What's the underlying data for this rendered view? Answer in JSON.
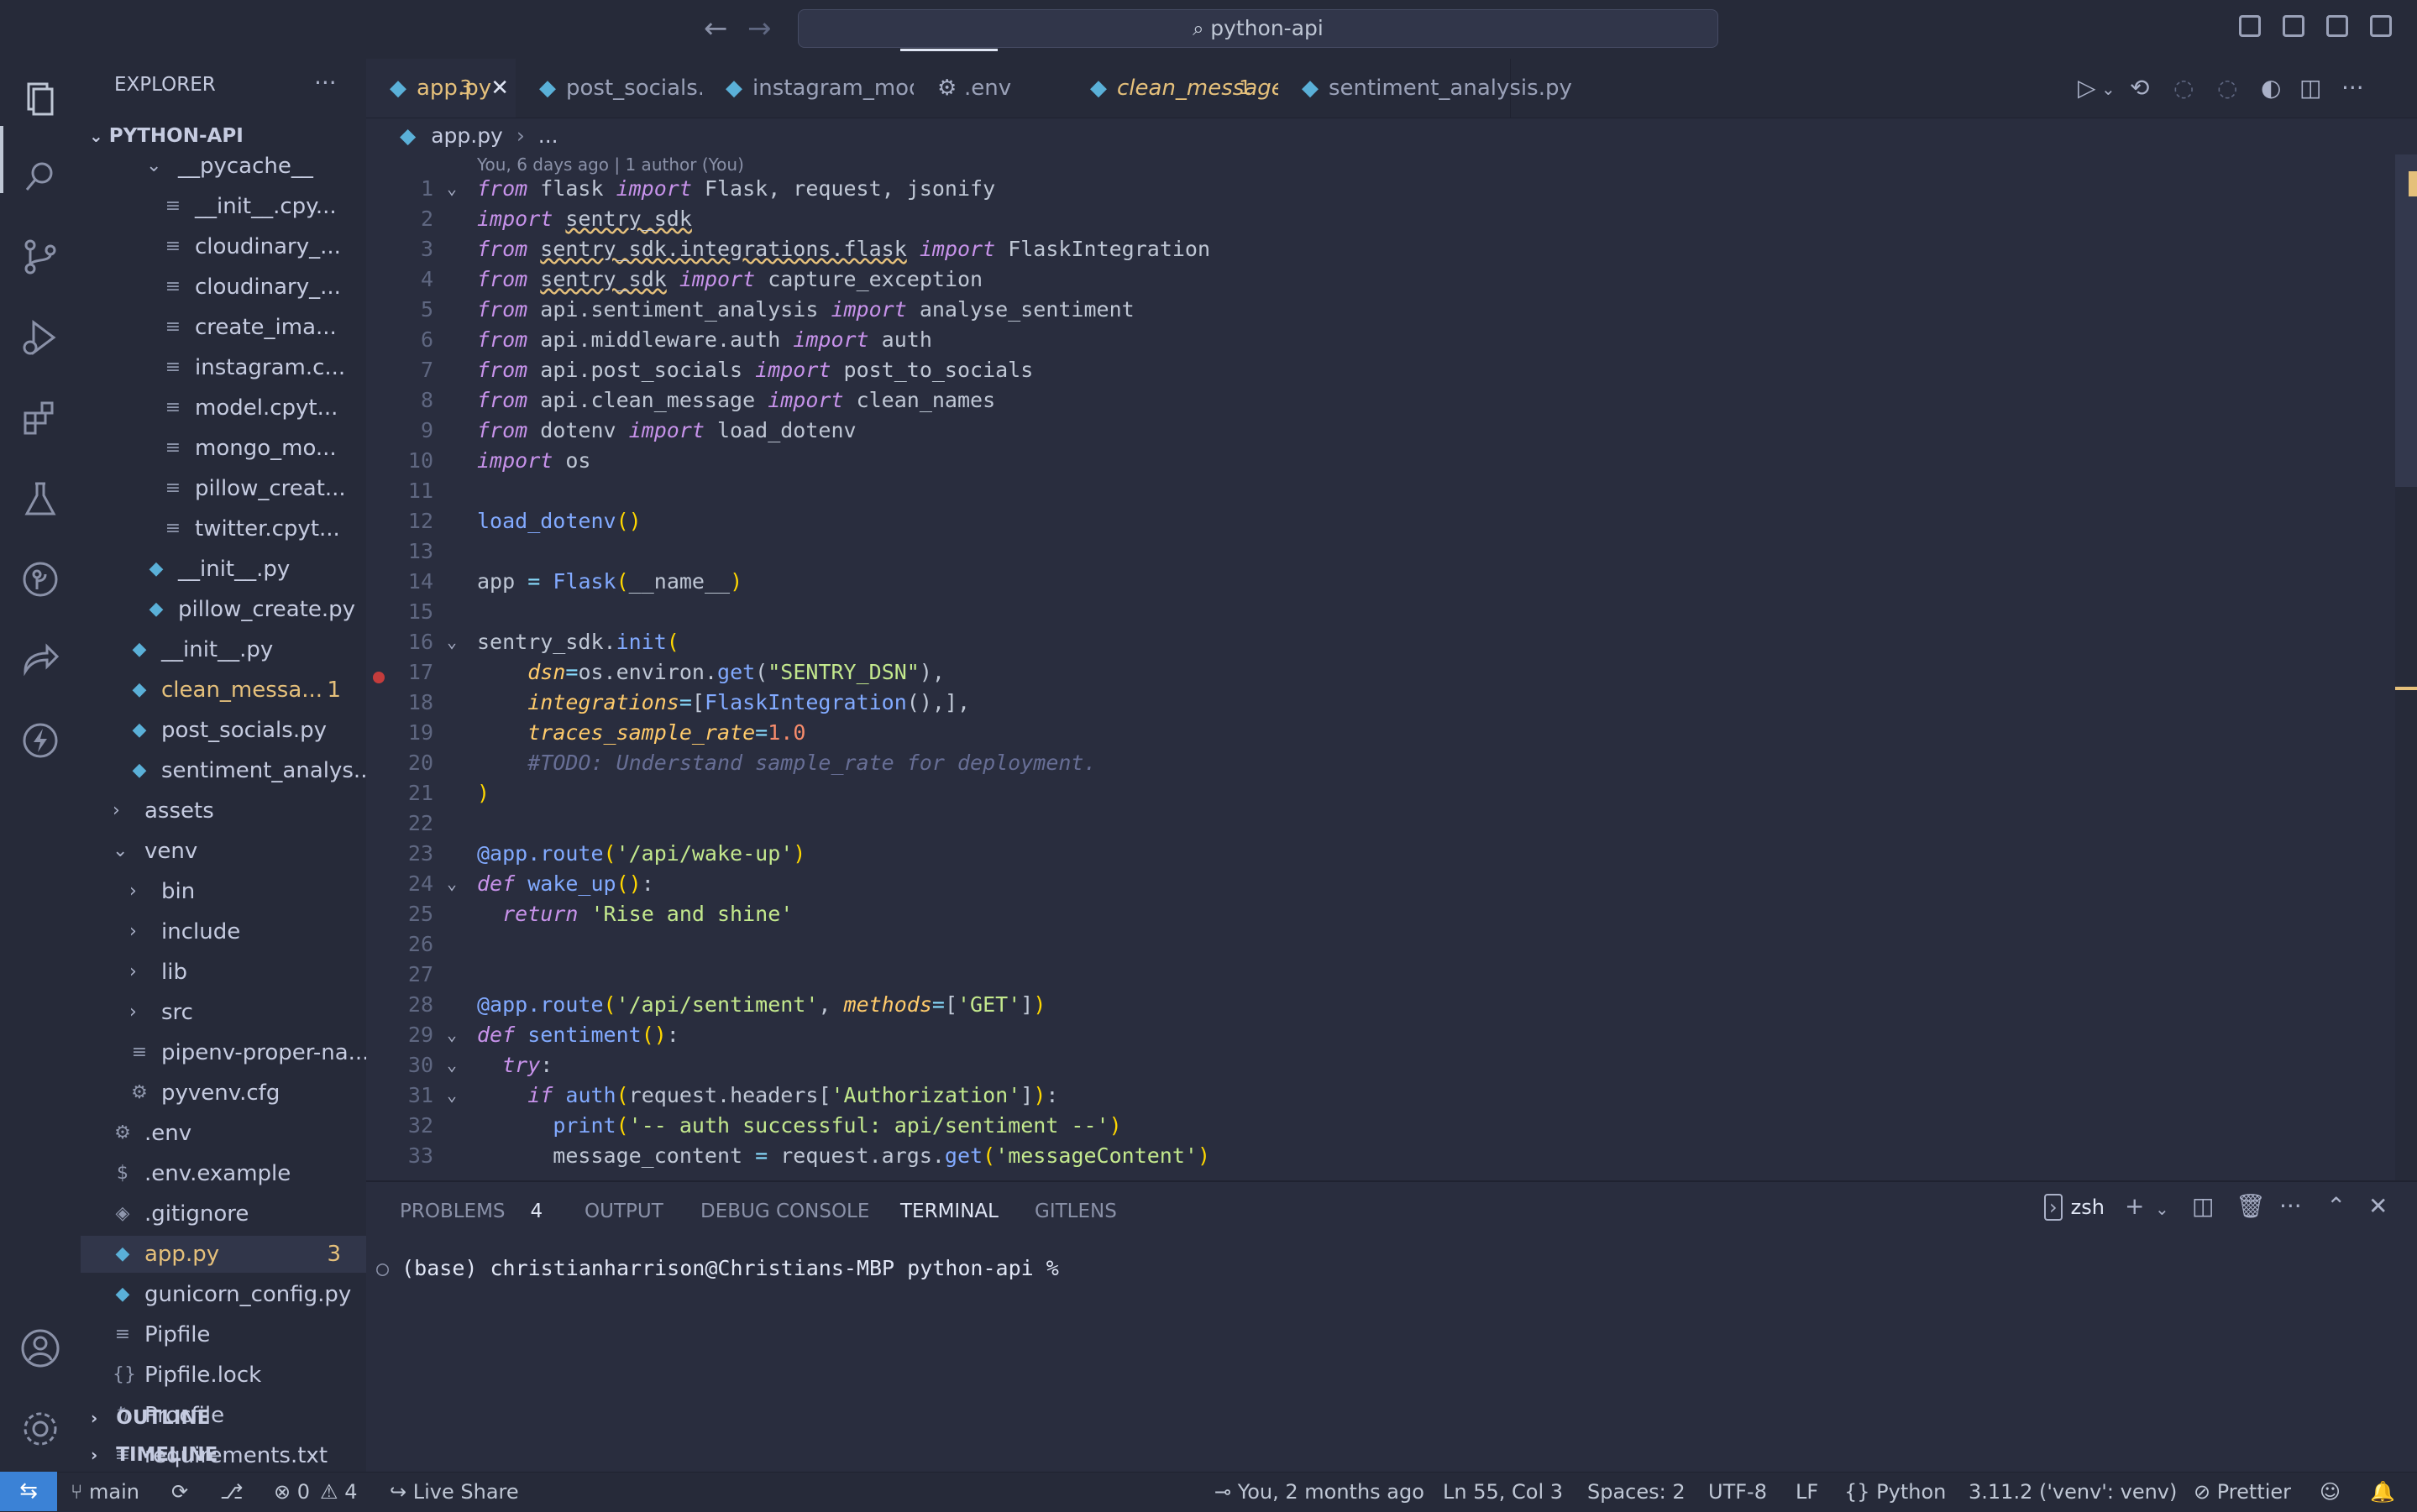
{
  "titlebar": {
    "search_text": "python-api"
  },
  "sidebar": {
    "title": "EXPLORER",
    "root": "PYTHON-API",
    "items": [
      {
        "label": "__pycache__",
        "kind": "folder-open",
        "indent": 3
      },
      {
        "label": "__init__.cpy...",
        "kind": "txt",
        "indent": 4
      },
      {
        "label": "cloudinary_...",
        "kind": "txt",
        "indent": 4
      },
      {
        "label": "cloudinary_...",
        "kind": "txt",
        "indent": 4
      },
      {
        "label": "create_ima...",
        "kind": "txt",
        "indent": 4
      },
      {
        "label": "instagram.c...",
        "kind": "txt",
        "indent": 4
      },
      {
        "label": "model.cpyt...",
        "kind": "txt",
        "indent": 4
      },
      {
        "label": "mongo_mo...",
        "kind": "txt",
        "indent": 4
      },
      {
        "label": "pillow_creat...",
        "kind": "txt",
        "indent": 4
      },
      {
        "label": "twitter.cpyt...",
        "kind": "txt",
        "indent": 4
      },
      {
        "label": "__init__.py",
        "kind": "py",
        "indent": 3
      },
      {
        "label": "pillow_create.py",
        "kind": "py",
        "indent": 3
      },
      {
        "label": "__init__.py",
        "kind": "py",
        "indent": 2
      },
      {
        "label": "clean_messa...",
        "kind": "py",
        "indent": 2,
        "badge": "1",
        "warn": true
      },
      {
        "label": "post_socials.py",
        "kind": "py",
        "indent": 2
      },
      {
        "label": "sentiment_analys...",
        "kind": "py",
        "indent": 2
      },
      {
        "label": "assets",
        "kind": "folder",
        "indent": 1
      },
      {
        "label": "venv",
        "kind": "folder-open",
        "indent": 1
      },
      {
        "label": "bin",
        "kind": "folder",
        "indent": 2
      },
      {
        "label": "include",
        "kind": "folder",
        "indent": 2
      },
      {
        "label": "lib",
        "kind": "folder",
        "indent": 2
      },
      {
        "label": "src",
        "kind": "folder",
        "indent": 2
      },
      {
        "label": "pipenv-proper-na...",
        "kind": "txt",
        "indent": 2
      },
      {
        "label": "pyvenv.cfg",
        "kind": "gear",
        "indent": 2
      },
      {
        "label": ".env",
        "kind": "gear",
        "indent": 1
      },
      {
        "label": ".env.example",
        "kind": "dollar",
        "indent": 1
      },
      {
        "label": ".gitignore",
        "kind": "git",
        "indent": 1
      },
      {
        "label": "app.py",
        "kind": "py",
        "indent": 1,
        "badge": "3",
        "warn": true,
        "selected": true
      },
      {
        "label": "gunicorn_config.py",
        "kind": "py",
        "indent": 1
      },
      {
        "label": "Pipfile",
        "kind": "txt",
        "indent": 1
      },
      {
        "label": "Pipfile.lock",
        "kind": "json",
        "indent": 1
      },
      {
        "label": "Procfile",
        "kind": "proc",
        "indent": 1
      },
      {
        "label": "requirements.txt",
        "kind": "txt",
        "indent": 1
      }
    ],
    "outline": "OUTLINE",
    "timeline": "TIMELINE"
  },
  "tabs": [
    {
      "label": "app.py",
      "badge": "3",
      "active": true
    },
    {
      "label": "post_socials.py"
    },
    {
      "label": "instagram_model.py"
    },
    {
      "label": ".env",
      "gear": true
    },
    {
      "label": "clean_message.py",
      "badge": "1",
      "warn": true
    },
    {
      "label": "sentiment_analysis.py"
    }
  ],
  "breadcrumb": {
    "file": "app.py",
    "rest": "..."
  },
  "blame": "You, 6 days ago | 1 author (You)",
  "code_lines": [
    "<span class=\"kw\">from</span> flask <span class=\"kw\">import</span> Flask, request, jsonify",
    "<span class=\"kw\">import</span> <span class=\"squig\">sentry_sdk</span>",
    "<span class=\"kw\">from</span> <span class=\"squig\">sentry_sdk.integrations.flask</span> <span class=\"kw\">import</span> FlaskIntegration",
    "<span class=\"kw\">from</span> <span class=\"squig\">sentry_sdk</span> <span class=\"kw\">import</span> capture_exception",
    "<span class=\"kw\">from</span> api.sentiment_analysis <span class=\"kw\">import</span> analyse_sentiment",
    "<span class=\"kw\">from</span> api.middleware.auth <span class=\"kw\">import</span> auth",
    "<span class=\"kw\">from</span> api.post_socials <span class=\"kw\">import</span> post_to_socials",
    "<span class=\"kw\">from</span> api.clean_message <span class=\"kw\">import</span> clean_names",
    "<span class=\"kw\">from</span> dotenv <span class=\"kw\">import</span> load_dotenv",
    "<span class=\"kw\">import</span> os",
    "",
    "<span class=\"fn\">load_dotenv</span><span class=\"br\">()</span>",
    "",
    "app <span class=\"op\">=</span> <span class=\"fn\">Flask</span><span class=\"br\">(</span>__name__<span class=\"br\">)</span>",
    "",
    "sentry_sdk.<span class=\"fn\">init</span><span class=\"br\">(</span>",
    "    <span class=\"prm\">dsn</span><span class=\"op\">=</span>os.environ.<span class=\"fn\">get</span>(<span class=\"str\">\"SENTRY_DSN\"</span>),",
    "    <span class=\"prm\">integrations</span><span class=\"op\">=</span>[<span class=\"fn\">FlaskIntegration</span>(),],",
    "    <span class=\"prm\">traces_sample_rate</span><span class=\"op\">=</span><span class=\"num\">1.0</span>",
    "    <span class=\"cmt\">#TODO: Understand sample_rate for deployment.</span>",
    "<span class=\"br\">)</span>",
    "",
    "<span class=\"fn\">@app.route</span><span class=\"br\">(</span><span class=\"str\">'/api/wake-up'</span><span class=\"br\">)</span>",
    "<span class=\"kw\">def</span> <span class=\"fn\">wake_up</span><span class=\"br\">()</span>:",
    "  <span class=\"kw\">return</span> <span class=\"str\">'Rise and shine'</span>",
    "",
    "",
    "<span class=\"fn\">@app.route</span><span class=\"br\">(</span><span class=\"str\">'/api/sentiment'</span>, <span class=\"prm\">methods</span><span class=\"op\">=</span>[<span class=\"str\">'GET'</span>]<span class=\"br\">)</span>",
    "<span class=\"kw\">def</span> <span class=\"fn\">sentiment</span><span class=\"br\">()</span>:",
    "  <span class=\"kw\">try</span>:",
    "    <span class=\"kw\">if</span> <span class=\"fn\">auth</span><span class=\"br\">(</span>request.headers[<span class=\"str\">'Authorization'</span>]<span class=\"br\">)</span>:",
    "      <span class=\"fn\">print</span><span class=\"br\">(</span><span class=\"str\">'-- auth successful: api/sentiment --'</span><span class=\"br\">)</span>",
    "      message_content <span class=\"op\">=</span> request.args.<span class=\"fn\">get</span><span class=\"br\">(</span><span class=\"str\">'messageContent'</span><span class=\"br\">)</span>"
  ],
  "folds": [
    1,
    16,
    24,
    29,
    30,
    31
  ],
  "panel": {
    "tabs": [
      "PROBLEMS",
      "OUTPUT",
      "DEBUG CONSOLE",
      "TERMINAL",
      "GITLENS"
    ],
    "problems_count": "4",
    "shell": "zsh",
    "terminal_line": "(base) christianharrison@Christians-MBP python-api % "
  },
  "statusbar": {
    "branch": "main",
    "errors": "0",
    "warnings": "4",
    "live_share": "Live Share",
    "blame": "You, 2 months ago",
    "position": "Ln 55, Col 3",
    "spaces": "Spaces: 2",
    "encoding": "UTF-8",
    "eol": "LF",
    "language": "Python",
    "interpreter": "3.11.2 ('venv': venv)",
    "formatter": "Prettier"
  }
}
